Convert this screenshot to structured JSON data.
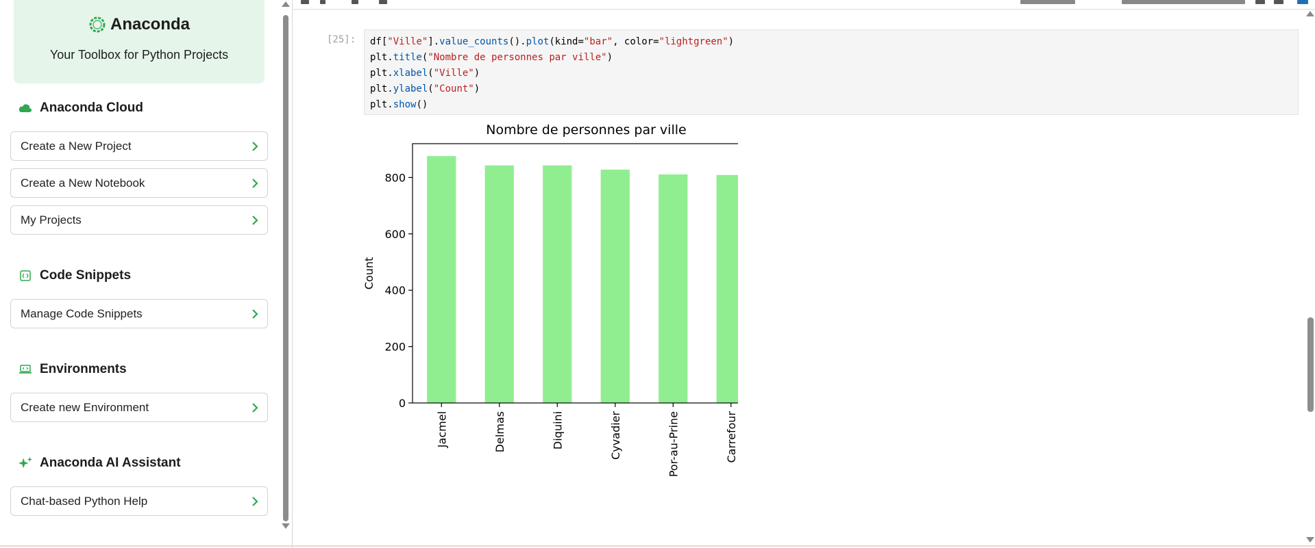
{
  "sidebar": {
    "brand": {
      "name": "Anaconda",
      "tagline": "Your Toolbox for Python Projects"
    },
    "sections": [
      {
        "title": "Anaconda Cloud",
        "icon": "cloud-icon",
        "buttons": [
          "Create a New Project",
          "Create a New Notebook",
          "My Projects"
        ]
      },
      {
        "title": "Code Snippets",
        "icon": "code-snippet-icon",
        "buttons": [
          "Manage Code Snippets"
        ]
      },
      {
        "title": "Environments",
        "icon": "laptop-code-icon",
        "buttons": [
          "Create new Environment"
        ]
      },
      {
        "title": "Anaconda AI Assistant",
        "icon": "sparkles-icon",
        "buttons": [
          "Chat-based Python Help"
        ]
      }
    ]
  },
  "notebook": {
    "cell": {
      "prompt": "[25]:",
      "code_lines": [
        "df[\"Ville\"].value_counts().plot(kind=\"bar\", color=\"lightgreen\")",
        "plt.title(\"Nombre de personnes par ville\")",
        "plt.xlabel(\"Ville\")",
        "plt.ylabel(\"Count\")",
        "plt.show()"
      ]
    }
  },
  "colors": {
    "accent": "#2fa84f",
    "bar": "#90ee90",
    "brand_bg": "#e6f5e9"
  },
  "chart_data": {
    "type": "bar",
    "title": "Nombre de personnes par ville",
    "xlabel": "",
    "ylabel": "Count",
    "categories": [
      "Jacmel",
      "Delmas",
      "Diquini",
      "Cyvadier",
      "Por-au-Prine",
      "Carrefour"
    ],
    "values": [
      876,
      843,
      843,
      828,
      811,
      809
    ],
    "ylim": [
      0,
      920
    ],
    "yticks": [
      0,
      200,
      400,
      600,
      800
    ],
    "grid": false,
    "color": "#90ee90"
  }
}
